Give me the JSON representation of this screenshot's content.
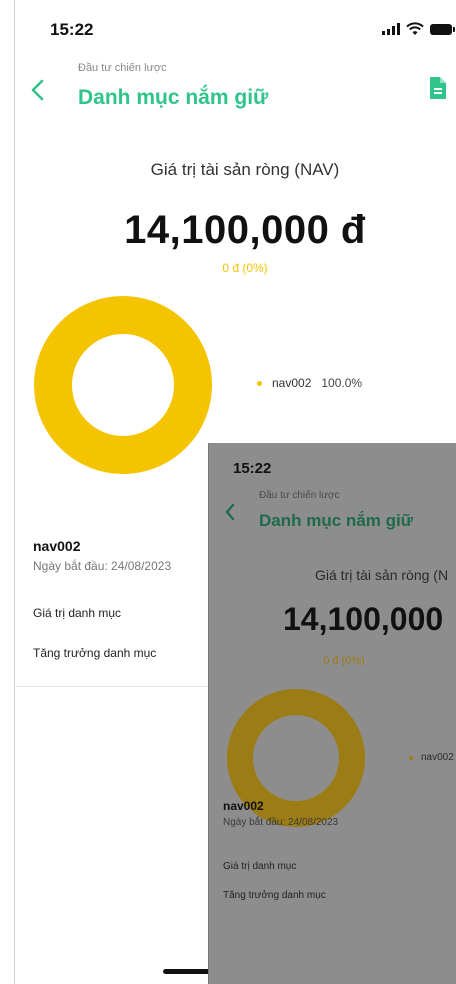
{
  "status": {
    "time": "15:22"
  },
  "header": {
    "subtitle": "Đầu tư chiến lược",
    "title": "Danh mục nắm giữ"
  },
  "nav": {
    "label": "Giá trị tài sản ròng (NAV)",
    "value": "14,100,000 đ",
    "change": "0 đ (0%)"
  },
  "chart_data": {
    "type": "pie",
    "categories": [
      "nav002"
    ],
    "values": [
      100.0
    ],
    "labels": [
      "100.0%"
    ],
    "colors": [
      "#f5c400"
    ]
  },
  "legend": {
    "name": "nav002",
    "percent": "100.0%"
  },
  "portfolio": {
    "name": "nav002",
    "start_date": "Ngày bắt đầu: 24/08/2023",
    "value_label": "Giá trị danh mục",
    "growth_label": "Tăng trưởng danh mục"
  },
  "preview": {
    "time": "15:22",
    "subtitle": "Đầu tư chiến lược",
    "title": "Danh mục nắm giữ",
    "nav_label": "Giá trị tài sản ròng (N",
    "nav_value": "14,100,000",
    "nav_change": "0 đ (0%)",
    "legend_name": "nav002",
    "name": "nav002",
    "start_date": "Ngày bắt đầu: 24/08/2023",
    "value_label": "Giá trị danh mục",
    "growth_label": "Tăng trưởng danh mục"
  },
  "colors": {
    "accent": "#2ec48a",
    "donut": "#f5c400"
  },
  "icons": {
    "back": "chevron-left-icon",
    "report": "document-icon"
  }
}
